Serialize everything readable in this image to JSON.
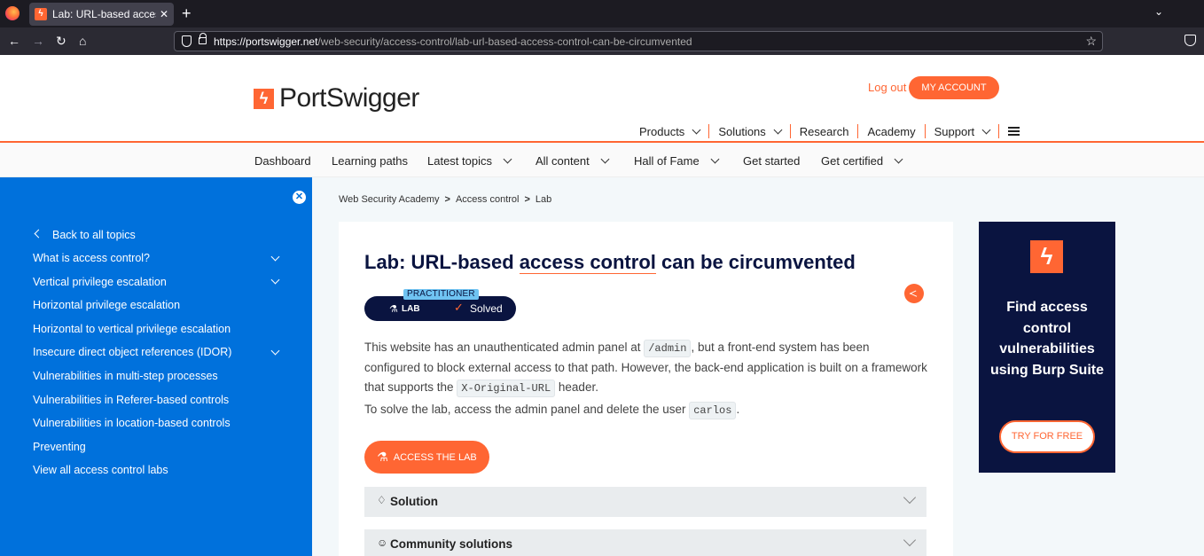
{
  "browser": {
    "tab_title": "Lab: URL-based access co",
    "url_domain": "https://portswigger.net",
    "url_path": "/web-security/access-control/lab-url-based-access-control-can-be-circumvented"
  },
  "header": {
    "logo_text": "PortSwigger",
    "logout": "Log out",
    "my_account": "MY ACCOUNT",
    "nav": [
      "Products",
      "Solutions",
      "Research",
      "Academy",
      "Support"
    ]
  },
  "subnav": [
    "Dashboard",
    "Learning paths",
    "Latest topics",
    "All content",
    "Hall of Fame",
    "Get started",
    "Get certified"
  ],
  "sidebar": {
    "back": "Back to all topics",
    "items": [
      "What is access control?",
      "Vertical privilege escalation",
      "Horizontal privilege escalation",
      "Horizontal to vertical privilege escalation",
      "Insecure direct object references (IDOR)",
      "Vulnerabilities in multi-step processes",
      "Vulnerabilities in Referer-based controls",
      "Vulnerabilities in location-based controls",
      "Preventing",
      "View all access control labs"
    ]
  },
  "breadcrumb": [
    "Web Security Academy",
    "Access control",
    "Lab"
  ],
  "lab": {
    "title_prefix": "Lab: URL-based ",
    "title_highlight": "access control",
    "title_suffix": " can be circumvented",
    "level": "PRACTITIONER",
    "type": "LAB",
    "status": "Solved",
    "desc_1": "This website has an unauthenticated admin panel at ",
    "code_admin": "/admin",
    "desc_2": ", but a front-end system has been configured to block external access to that path. However, the back-end application is built on a framework that supports the ",
    "code_header": "X-Original-URL",
    "desc_3": " header.",
    "solve_1": "To solve the lab, access the admin panel and delete the user ",
    "code_user": "carlos",
    "solve_2": ".",
    "access_button": "ACCESS THE LAB",
    "accordion": [
      "Solution",
      "Community solutions"
    ]
  },
  "ad": {
    "text": "Find access control vulnerabilities using Burp Suite",
    "button": "TRY FOR FREE"
  },
  "colors": {
    "brand": "#ff6633",
    "navy": "#0a1440",
    "sidebar": "#0071dc"
  }
}
